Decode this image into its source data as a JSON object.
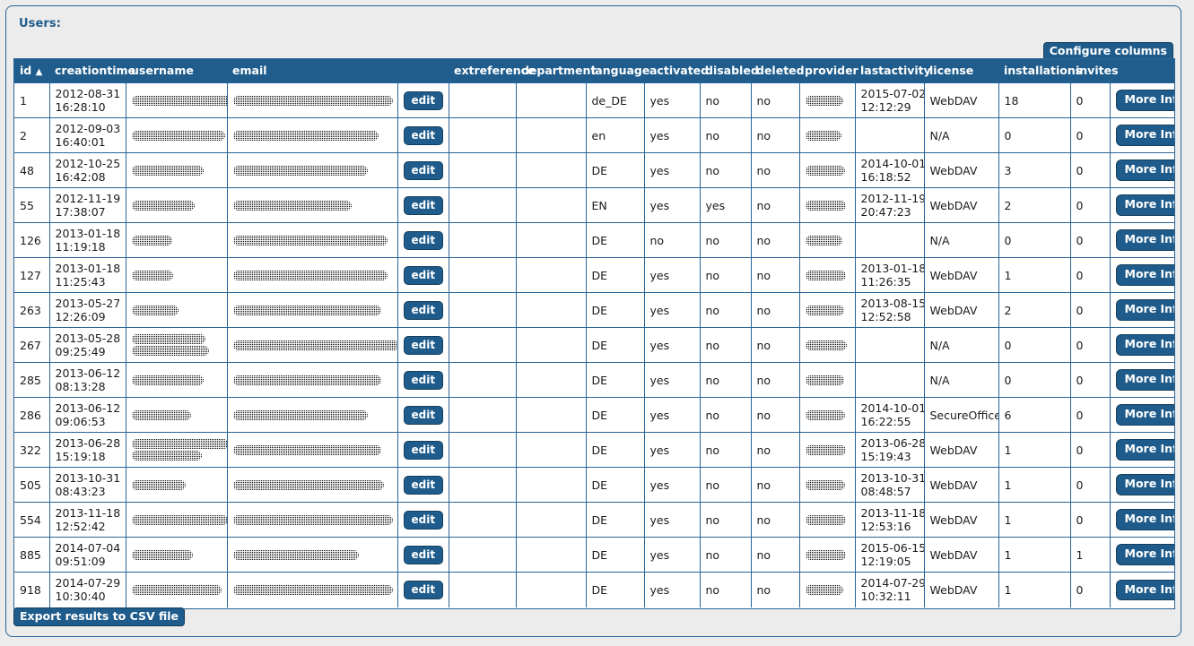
{
  "panel": {
    "title": "Users:"
  },
  "toolbar": {
    "configure_columns_label": "Configure columns",
    "export_csv_label": "Export results to CSV file"
  },
  "table": {
    "sort_column": "id",
    "sort_direction": "ascending",
    "sort_arrow_glyph": "▲",
    "edit_label": "edit",
    "more_info_label": "More Info",
    "columns": [
      {
        "key": "id",
        "label": "id",
        "sorted": true
      },
      {
        "key": "creationtime",
        "label": "creationtime"
      },
      {
        "key": "username",
        "label": "username"
      },
      {
        "key": "email",
        "label": "email"
      },
      {
        "key": "edit",
        "label": ""
      },
      {
        "key": "extreference",
        "label": "extreference"
      },
      {
        "key": "department",
        "label": "department"
      },
      {
        "key": "language",
        "label": "language"
      },
      {
        "key": "activated",
        "label": "activated"
      },
      {
        "key": "disabled",
        "label": "disabled"
      },
      {
        "key": "deleted",
        "label": "deleted"
      },
      {
        "key": "provider",
        "label": "provider"
      },
      {
        "key": "lastactivity",
        "label": "lastactivity"
      },
      {
        "key": "license",
        "label": "license"
      },
      {
        "key": "installations",
        "label": "installations"
      },
      {
        "key": "invites",
        "label": "invites"
      },
      {
        "key": "moreinfo",
        "label": ""
      }
    ],
    "rows": [
      {
        "id": "1",
        "creationtime": "2012-08-31 16:28:10",
        "username_redacted": [
          115
        ],
        "email_redacted": [
          178
        ],
        "extreference": "",
        "department": "",
        "language": "de_DE",
        "activated": "yes",
        "disabled": "no",
        "deleted": "no",
        "provider_redacted": [
          42
        ],
        "lastactivity": "2015-07-02 12:12:29",
        "license": "WebDAV",
        "installations": "18",
        "invites": "0"
      },
      {
        "id": "2",
        "creationtime": "2012-09-03 16:40:01",
        "username_redacted": [
          104
        ],
        "email_redacted": [
          162
        ],
        "extreference": "",
        "department": "",
        "language": "en",
        "activated": "yes",
        "disabled": "no",
        "deleted": "no",
        "provider_redacted": [
          40
        ],
        "lastactivity": "",
        "license": "N/A",
        "installations": "0",
        "invites": "0"
      },
      {
        "id": "48",
        "creationtime": "2012-10-25 16:42:08",
        "username_redacted": [
          80
        ],
        "email_redacted": [
          150
        ],
        "extreference": "",
        "department": "",
        "language": "DE",
        "activated": "yes",
        "disabled": "no",
        "deleted": "no",
        "provider_redacted": [
          44
        ],
        "lastactivity": "2014-10-01 16:18:52",
        "license": "WebDAV",
        "installations": "3",
        "invites": "0"
      },
      {
        "id": "55",
        "creationtime": "2012-11-19 17:38:07",
        "username_redacted": [
          70
        ],
        "email_redacted": [
          132
        ],
        "extreference": "",
        "department": "",
        "language": "EN",
        "activated": "yes",
        "disabled": "yes",
        "deleted": "no",
        "provider_redacted": [
          45
        ],
        "lastactivity": "2012-11-19 20:47:23",
        "license": "WebDAV",
        "installations": "2",
        "invites": "0"
      },
      {
        "id": "126",
        "creationtime": "2013-01-18 11:19:18",
        "username_redacted": [
          45
        ],
        "email_redacted": [
          172
        ],
        "extreference": "",
        "department": "",
        "language": "DE",
        "activated": "no",
        "disabled": "no",
        "deleted": "no",
        "provider_redacted": [
          41
        ],
        "lastactivity": "",
        "license": "N/A",
        "installations": "0",
        "invites": "0"
      },
      {
        "id": "127",
        "creationtime": "2013-01-18 11:25:43",
        "username_redacted": [
          46
        ],
        "email_redacted": [
          172
        ],
        "extreference": "",
        "department": "",
        "language": "DE",
        "activated": "yes",
        "disabled": "no",
        "deleted": "no",
        "provider_redacted": [
          45
        ],
        "lastactivity": "2013-01-18 11:26:35",
        "license": "WebDAV",
        "installations": "1",
        "invites": "0"
      },
      {
        "id": "263",
        "creationtime": "2013-05-27 12:26:09",
        "username_redacted": [
          52
        ],
        "email_redacted": [
          165
        ],
        "extreference": "",
        "department": "",
        "language": "DE",
        "activated": "yes",
        "disabled": "no",
        "deleted": "no",
        "provider_redacted": [
          43
        ],
        "lastactivity": "2013-08-15 12:52:58",
        "license": "WebDAV",
        "installations": "2",
        "invites": "0"
      },
      {
        "id": "267",
        "creationtime": "2013-05-28 09:25:49",
        "username_redacted": [
          82,
          86
        ],
        "email_redacted": [
          185
        ],
        "extreference": "",
        "department": "",
        "language": "DE",
        "activated": "yes",
        "disabled": "no",
        "deleted": "no",
        "provider_redacted": [
          46
        ],
        "lastactivity": "",
        "license": "N/A",
        "installations": "0",
        "invites": "0"
      },
      {
        "id": "285",
        "creationtime": "2013-06-12 08:13:28",
        "username_redacted": [
          80
        ],
        "email_redacted": [
          165
        ],
        "extreference": "",
        "department": "",
        "language": "DE",
        "activated": "yes",
        "disabled": "no",
        "deleted": "no",
        "provider_redacted": [
          43
        ],
        "lastactivity": "",
        "license": "N/A",
        "installations": "0",
        "invites": "0"
      },
      {
        "id": "286",
        "creationtime": "2013-06-12 09:06:53",
        "username_redacted": [
          66
        ],
        "email_redacted": [
          150
        ],
        "extreference": "",
        "department": "",
        "language": "DE",
        "activated": "yes",
        "disabled": "no",
        "deleted": "no",
        "provider_redacted": [
          44
        ],
        "lastactivity": "2014-10-01 16:22:55",
        "license": "SecureOffice",
        "installations": "6",
        "invites": "0"
      },
      {
        "id": "322",
        "creationtime": "2013-06-28 15:19:18",
        "username_redacted": [
          108,
          78
        ],
        "email_redacted": [
          165
        ],
        "extreference": "",
        "department": "",
        "language": "DE",
        "activated": "yes",
        "disabled": "no",
        "deleted": "no",
        "provider_redacted": [
          45
        ],
        "lastactivity": "2013-06-28 15:19:43",
        "license": "WebDAV",
        "installations": "1",
        "invites": "0"
      },
      {
        "id": "505",
        "creationtime": "2013-10-31 08:43:23",
        "username_redacted": [
          60
        ],
        "email_redacted": [
          168
        ],
        "extreference": "",
        "department": "",
        "language": "DE",
        "activated": "yes",
        "disabled": "no",
        "deleted": "no",
        "provider_redacted": [
          44
        ],
        "lastactivity": "2013-10-31 08:48:57",
        "license": "WebDAV",
        "installations": "1",
        "invites": "0"
      },
      {
        "id": "554",
        "creationtime": "2013-11-18 12:52:42",
        "username_redacted": [
          107
        ],
        "email_redacted": [
          178
        ],
        "extreference": "",
        "department": "",
        "language": "DE",
        "activated": "yes",
        "disabled": "no",
        "deleted": "no",
        "provider_redacted": [
          45
        ],
        "lastactivity": "2013-11-18 12:53:16",
        "license": "WebDAV",
        "installations": "1",
        "invites": "0"
      },
      {
        "id": "885",
        "creationtime": "2014-07-04 09:51:09",
        "username_redacted": [
          68
        ],
        "email_redacted": [
          140
        ],
        "extreference": "",
        "department": "",
        "language": "DE",
        "activated": "yes",
        "disabled": "no",
        "deleted": "no",
        "provider_redacted": [
          45
        ],
        "lastactivity": "2015-06-15 12:19:05",
        "license": "WebDAV",
        "installations": "1",
        "invites": "1"
      },
      {
        "id": "918",
        "creationtime": "2014-07-29 10:30:40",
        "username_redacted": [
          100
        ],
        "email_redacted": [
          178
        ],
        "extreference": "",
        "department": "",
        "language": "DE",
        "activated": "yes",
        "disabled": "no",
        "deleted": "no",
        "provider_redacted": [
          42
        ],
        "lastactivity": "2014-07-29 10:32:11",
        "license": "WebDAV",
        "installations": "1",
        "invites": "0"
      }
    ]
  },
  "colors": {
    "header_blue": "#205d8c",
    "button_blue": "#1f5c8b",
    "border_blue": "#2a6496",
    "page_background": "#ececec",
    "link_text": "#3c6a8c"
  }
}
